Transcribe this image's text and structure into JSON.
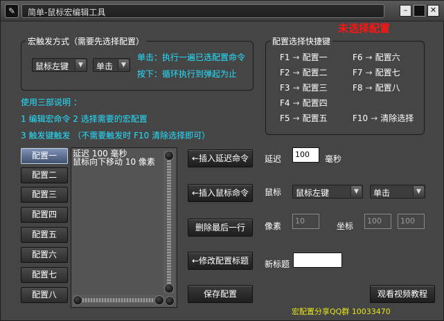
{
  "window": {
    "title": "简单-鼠标宏编辑工具",
    "icon": "pencil-icon"
  },
  "window_controls": {
    "minimize": "–",
    "maximize": "■",
    "close": "✕"
  },
  "status": {
    "not_selected": "未选择配置",
    "color": "#ff1414"
  },
  "macro_trigger": {
    "legend": "宏触发方式（需要先选择配置）",
    "mouse_button": "鼠标左键",
    "click_mode": "单击",
    "desc_click": "单击：执行一遍已选配置命令",
    "desc_hold": "按下：循环执行到弹起为止"
  },
  "hotkeys": {
    "legend": "配置选择快捷键",
    "arrow": "→",
    "items": [
      {
        "key": "F1",
        "target": "配置一"
      },
      {
        "key": "F2",
        "target": "配置二"
      },
      {
        "key": "F3",
        "target": "配置三"
      },
      {
        "key": "F4",
        "target": "配置四"
      },
      {
        "key": "F5",
        "target": "配置五"
      },
      {
        "key": "F6",
        "target": "配置六"
      },
      {
        "key": "F7",
        "target": "配置七"
      },
      {
        "key": "F8",
        "target": "配置八"
      },
      {
        "key": "F10",
        "target": "清除选择"
      }
    ]
  },
  "instructions": {
    "title": "使用三部说明 ：",
    "step1": "1 编辑宏命令  2 选择需要的宏配置",
    "step2": "3 触发键触发 （不需要触发时 F10 清除选择即可）"
  },
  "configs": [
    "配置一",
    "配置二",
    "配置三",
    "配置四",
    "配置五",
    "配置六",
    "配置七",
    "配置八"
  ],
  "command_list": [
    "延迟 100 毫秒",
    "鼠标向下移动 10 像素"
  ],
  "actions": {
    "insert_delay": "←插入延迟命令",
    "insert_mouse": "←插入鼠标命令",
    "delete_last": "删除最后一行",
    "rename": "←修改配置标题",
    "save": "保存配置",
    "watch_video": "观看视频教程"
  },
  "fields": {
    "delay_label": "延迟",
    "delay_value": "100",
    "delay_unit": "毫秒",
    "mouse_label": "鼠标",
    "mouse_button": "鼠标左键",
    "mouse_action": "单击",
    "pixel_label": "像素",
    "pixel_value": "10",
    "coord_label": "坐标",
    "coord_x": "100",
    "coord_y": "100",
    "new_title_label": "新标题",
    "new_title_value": ""
  },
  "footer": {
    "text": "宏配置分享QQ群 10033470",
    "color": "#e8e61a"
  },
  "colors": {
    "accent_cyan": "#25e0ff",
    "background": "#454545",
    "active_tab": "#5a6c90"
  }
}
